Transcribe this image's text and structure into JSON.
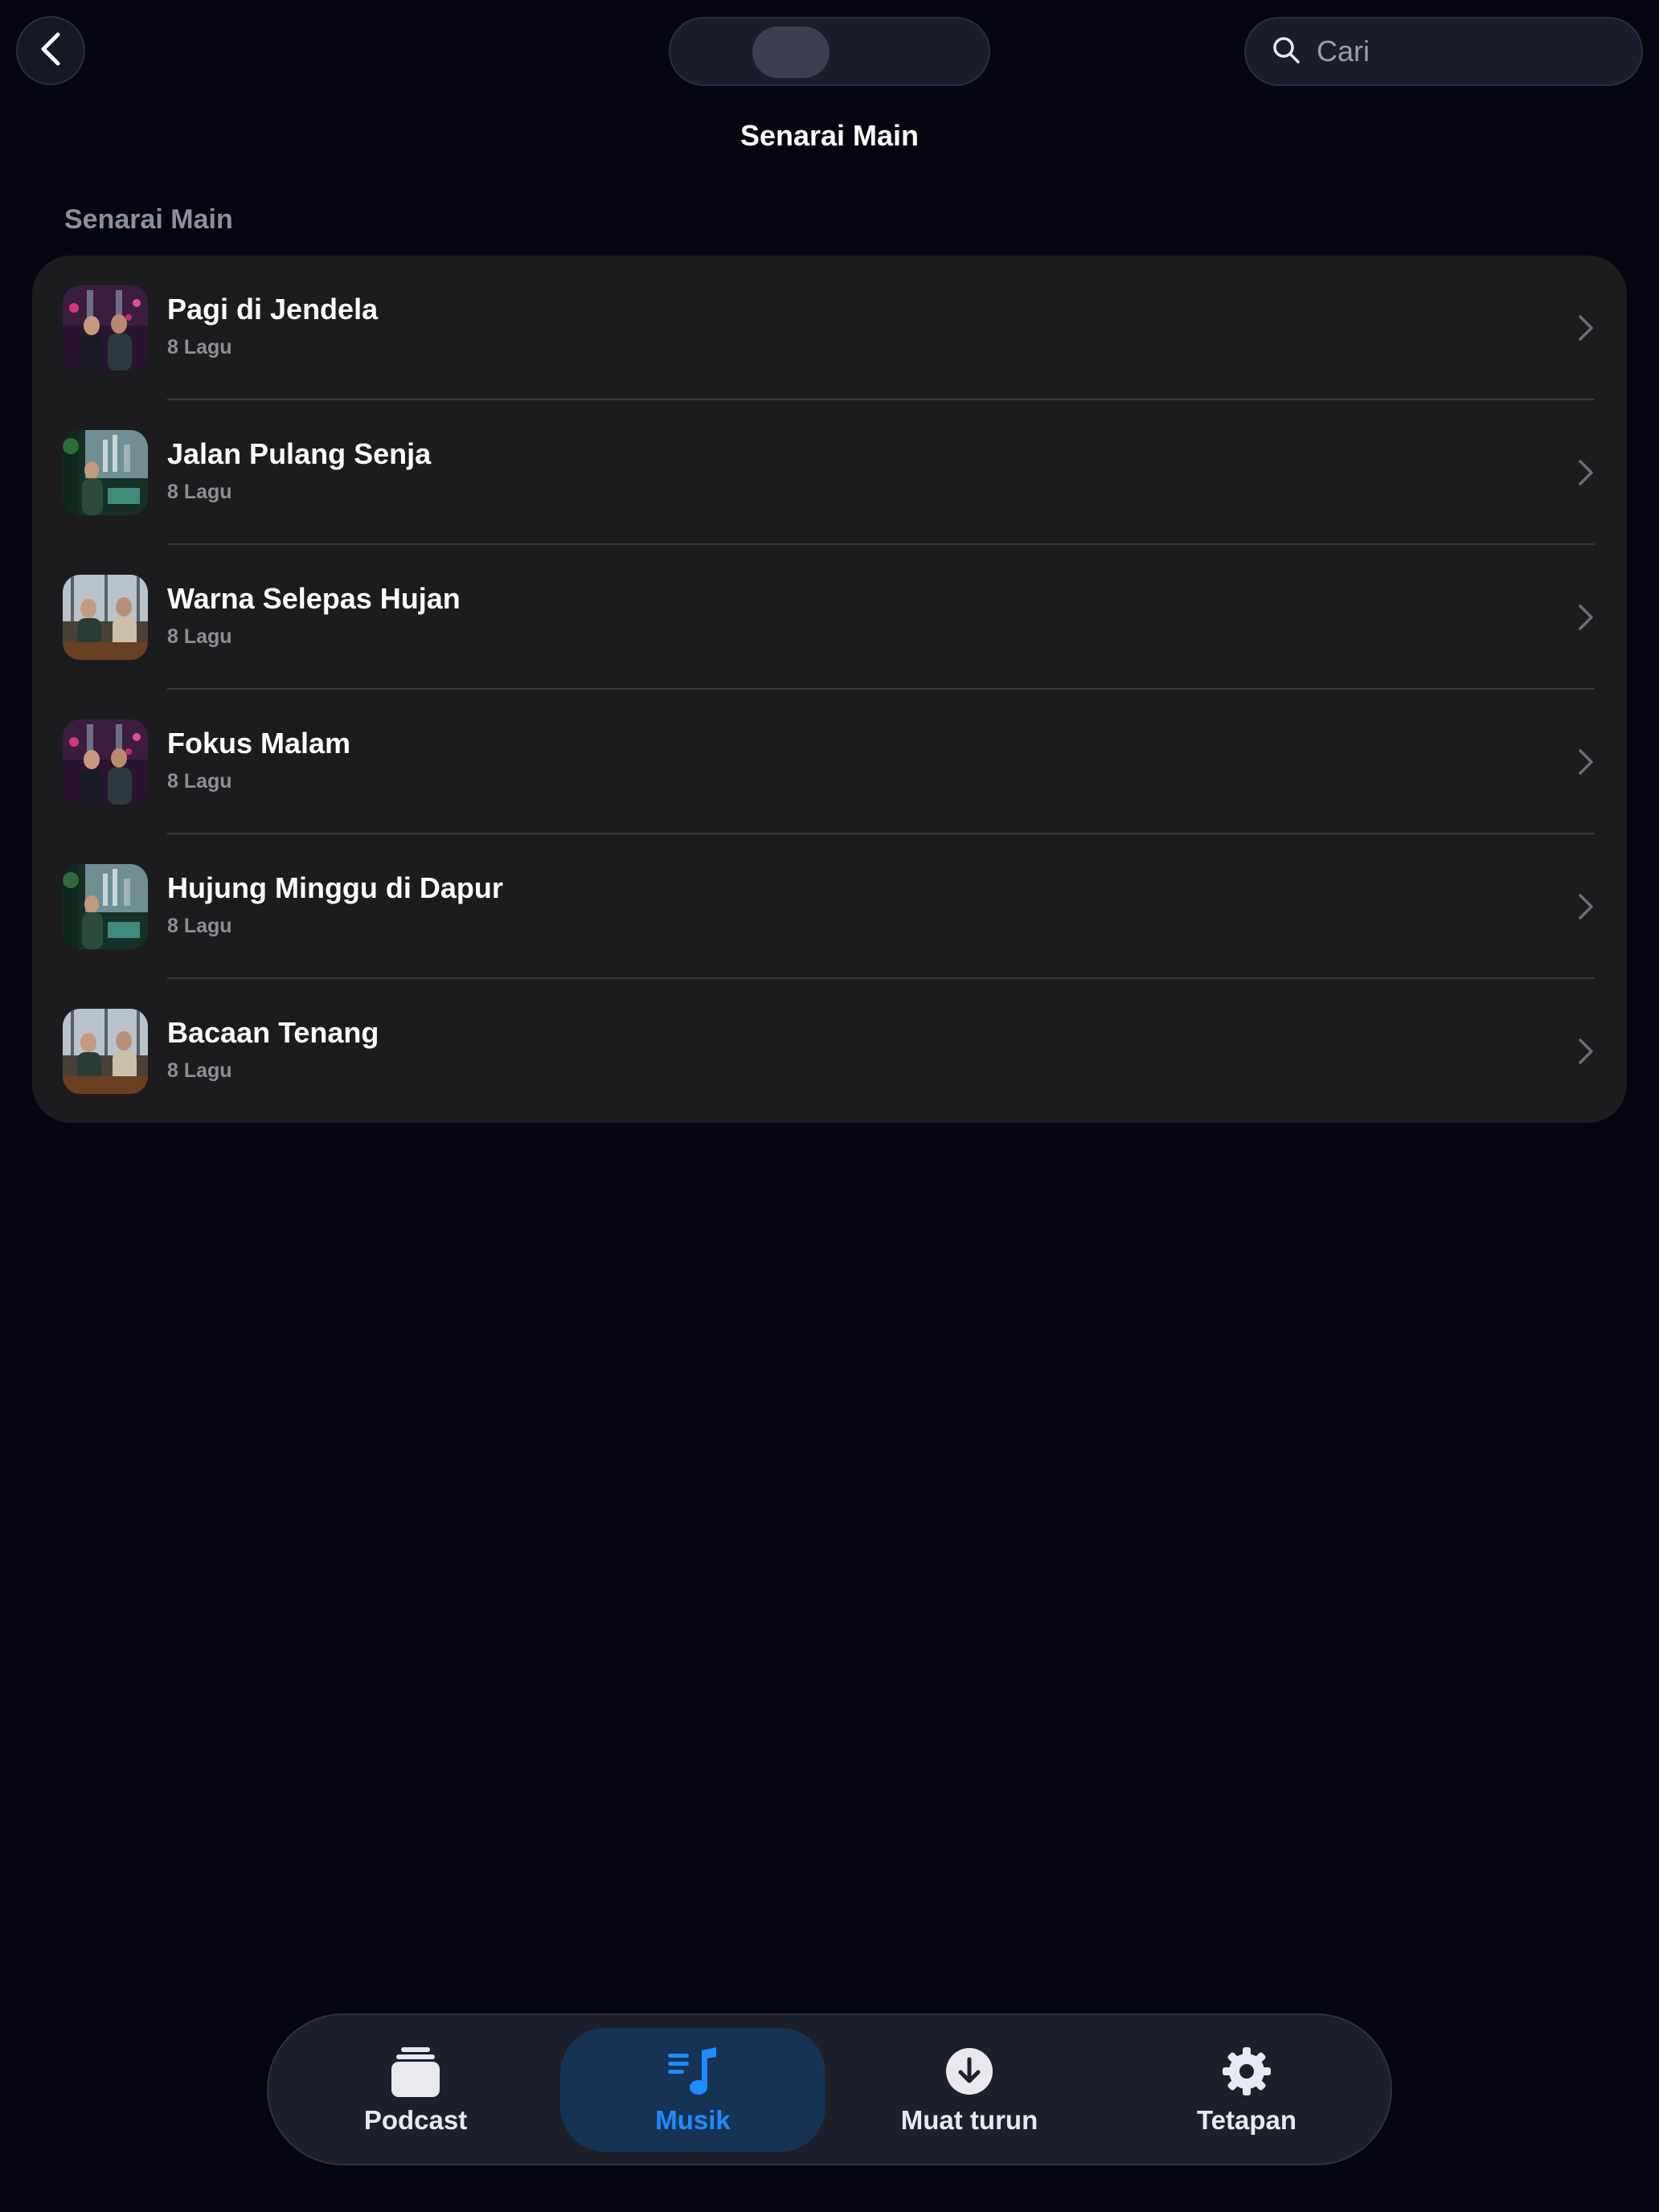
{
  "colors": {
    "background": "#05060f",
    "card": "#1c1c1f",
    "accent": "#1e8bff",
    "active_tab_bg": "#173354"
  },
  "header": {
    "back_icon": "chevron-left-icon",
    "search_placeholder": "Cari",
    "search_icon": "search-icon",
    "title": "Senarai Main"
  },
  "section": {
    "title": "Senarai Main"
  },
  "playlists": [
    {
      "title": "Pagi di Jendela",
      "subtitle": "8 Lagu",
      "artwork": "city-night-duo"
    },
    {
      "title": "Jalan Pulang Senja",
      "subtitle": "8 Lagu",
      "artwork": "green-city-window"
    },
    {
      "title": "Warna Selepas Hujan",
      "subtitle": "8 Lagu",
      "artwork": "studio-duo"
    },
    {
      "title": "Fokus Malam",
      "subtitle": "8 Lagu",
      "artwork": "city-night-duo"
    },
    {
      "title": "Hujung Minggu di Dapur",
      "subtitle": "8 Lagu",
      "artwork": "green-city-window"
    },
    {
      "title": "Bacaan Tenang",
      "subtitle": "8 Lagu",
      "artwork": "studio-duo"
    }
  ],
  "tabs": [
    {
      "label": "Podcast",
      "icon": "stack-icon",
      "active": false
    },
    {
      "label": "Musik",
      "icon": "music-note-icon",
      "active": true
    },
    {
      "label": "Muat turun",
      "icon": "download-icon",
      "active": false
    },
    {
      "label": "Tetapan",
      "icon": "gear-icon",
      "active": false
    }
  ]
}
